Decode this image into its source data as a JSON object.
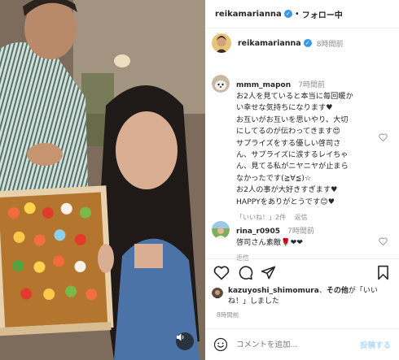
{
  "header": {
    "username": "reikamarianna",
    "separator": "•",
    "follow_status": "フォロー中"
  },
  "post": {
    "author": "reikamarianna",
    "time": "8時間前"
  },
  "comments": [
    {
      "username": "mmm_mapon",
      "time": "7時間前",
      "text": "お2人を見ていると本当に毎回暖か\nい幸せな気持ちになります♥\nお互いがお互いを思いやり、大切\nにしてるのが伝わってきます😍\nサプライズをする優しい啓司さ\nん、サプライズに涙するレイちゃ\nん、見てる私がニヤニヤが止まら\nなかったです(≧∀≦)☆\nお2人の事が大好きすぎます♥\nHAPPYをありがとうです😊♥",
      "likes": "「いいね！」2件",
      "reply": "返信"
    },
    {
      "username": "rina_r0905",
      "time": "7時間前",
      "text": "啓司さん素敵🌹❤❤",
      "reply": "返信"
    }
  ],
  "likes": {
    "user": "kazuyoshi_shimomura",
    "others": "その他",
    "suffix_1": "が「いい",
    "suffix_2": "ね！」しました"
  },
  "timestamp": "8時間前",
  "comment_input": {
    "placeholder": "コメントを追加...",
    "post_label": "投稿する"
  },
  "icons": {
    "verified": "verified-badge-icon",
    "like": "heart-icon",
    "comment": "comment-bubble-icon",
    "share": "paper-plane-icon",
    "save": "bookmark-icon",
    "mute": "speaker-icon",
    "emoji": "emoji-icon"
  },
  "colors": {
    "verified_blue": "#3897f0",
    "meta_gray": "#8e8e8e",
    "post_button": "#b3dbff"
  }
}
